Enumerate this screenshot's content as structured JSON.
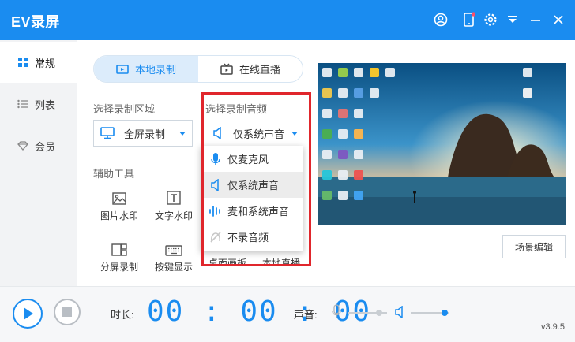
{
  "window": {
    "title": "EV录屏"
  },
  "sidebar": {
    "items": [
      {
        "label": "常规"
      },
      {
        "label": "列表"
      },
      {
        "label": "会员"
      }
    ]
  },
  "mode_tabs": [
    {
      "label": "本地录制",
      "active": true
    },
    {
      "label": "在线直播",
      "active": false
    }
  ],
  "record_area": {
    "label": "选择录制区域",
    "value": "全屏录制"
  },
  "audio": {
    "label": "选择录制音频",
    "value": "仅系统声音",
    "options": [
      {
        "label": "仅麦克风",
        "icon": "microphone-icon"
      },
      {
        "label": "仅系统声音",
        "icon": "speaker-icon"
      },
      {
        "label": "麦和系统声音",
        "icon": "sound-wave-icon"
      },
      {
        "label": "不录音频",
        "icon": "mute-icon"
      }
    ]
  },
  "tools": {
    "label": "辅助工具",
    "items": [
      {
        "label": "图片水印"
      },
      {
        "label": "文字水印"
      },
      {
        "label": "分屏录制"
      },
      {
        "label": "按键显示"
      }
    ],
    "hidden_labels": [
      "桌面画板",
      "本地直播"
    ]
  },
  "scene_button": "场景编辑",
  "bottom": {
    "duration_label": "时长:",
    "timer": "00:00:00",
    "volume_label": "声音:",
    "mic_level": 0.8,
    "system_level": 0.9,
    "version": "v3.9.5"
  },
  "colors": {
    "accent": "#1a8cf0",
    "highlight": "#e0262c"
  }
}
